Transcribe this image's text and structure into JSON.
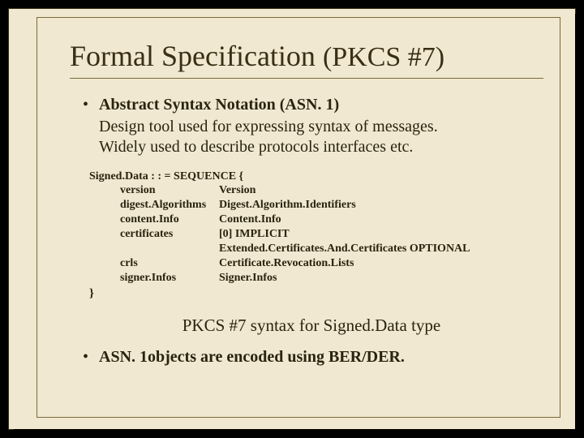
{
  "title": {
    "main": "Formal Specification ",
    "paren": "(PKCS #7)"
  },
  "bullet1": {
    "head": "Abstract Syntax Notation (ASN. 1)",
    "line1": "Design tool used for expressing syntax of messages.",
    "line2": "Widely used to describe protocols interfaces etc."
  },
  "asn": {
    "seq": "Signed.Data : : = SEQUENCE {",
    "rows": [
      {
        "field": "version",
        "type": "Version"
      },
      {
        "field": "digest.Algorithms",
        "type": "Digest.Algorithm.Identifiers"
      },
      {
        "field": "content.Info",
        "type": "Content.Info"
      },
      {
        "field": "certificates",
        "type": "[0]  IMPLICIT"
      },
      {
        "field": "",
        "type": "Extended.Certificates.And.Certificates OPTIONAL"
      },
      {
        "field": "crls",
        "type": "Certificate.Revocation.Lists"
      },
      {
        "field": "signer.Infos",
        "type": "Signer.Infos"
      }
    ],
    "close": "}"
  },
  "caption": "PKCS #7 syntax for Signed.Data type",
  "bullet2": {
    "head": "ASN. 1objects are encoded using BER/DER."
  }
}
